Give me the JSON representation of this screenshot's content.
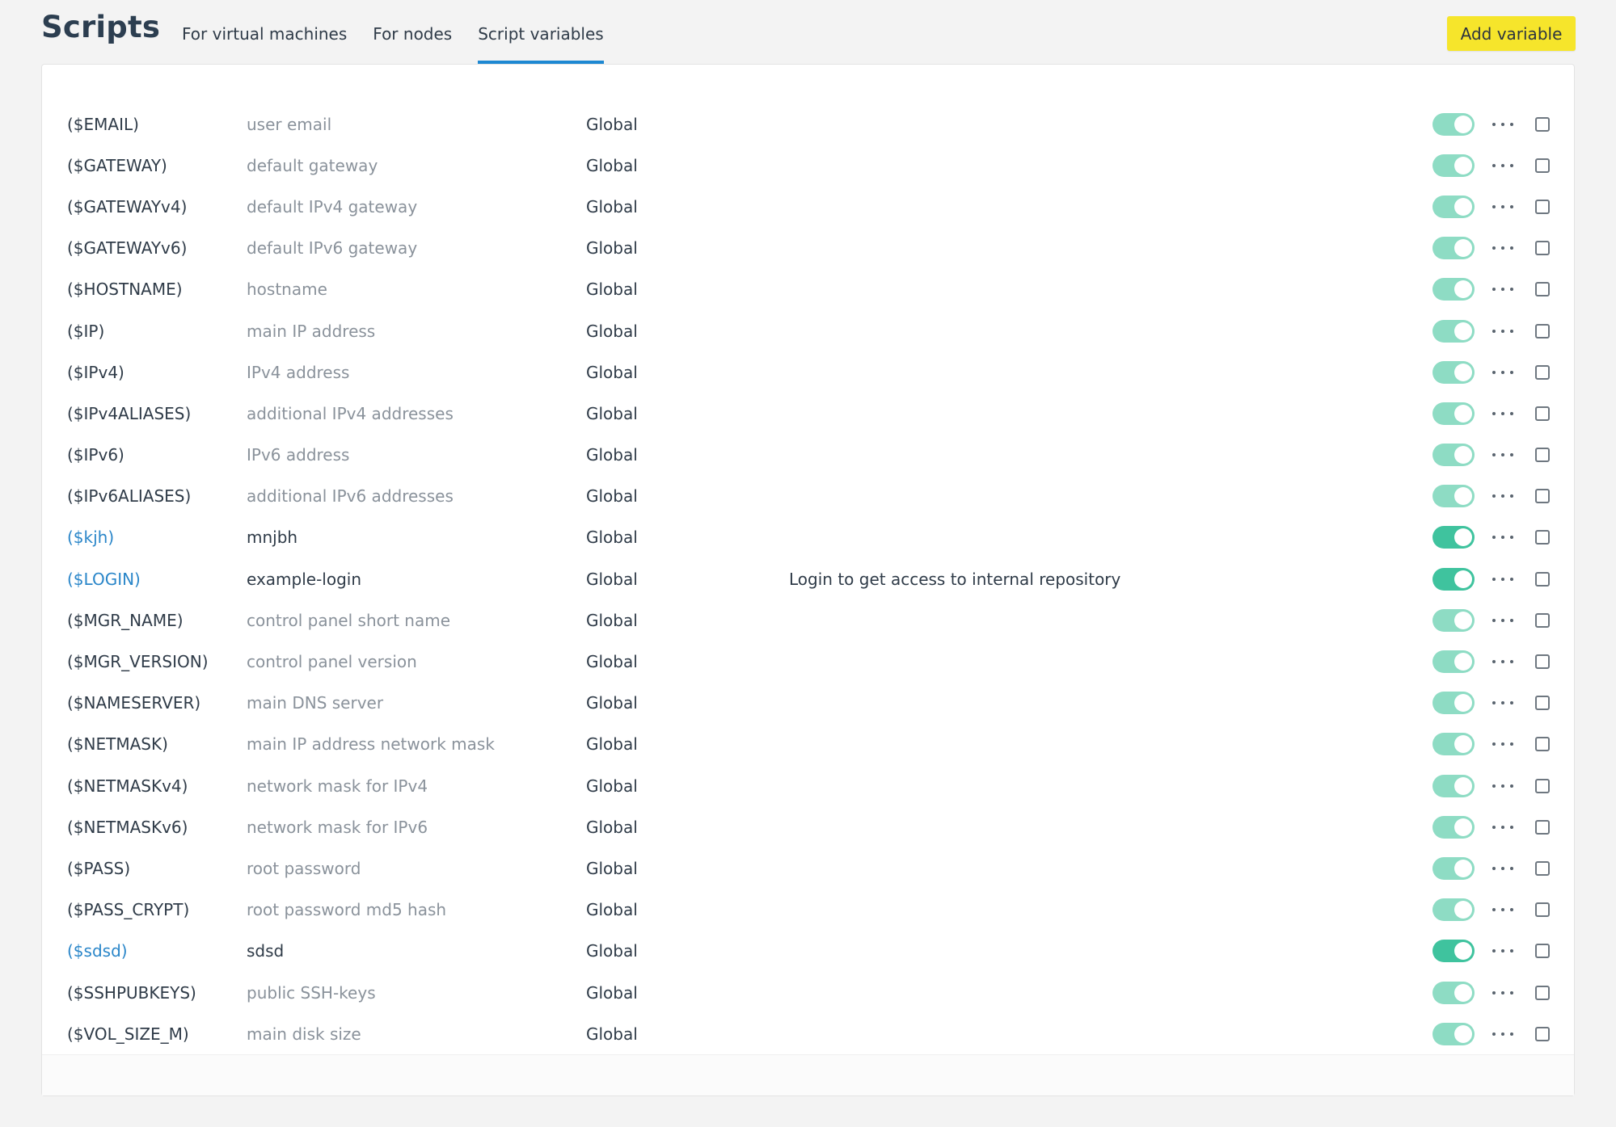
{
  "header": {
    "title": "Scripts",
    "tabs": [
      {
        "label": "For virtual machines",
        "active": false
      },
      {
        "label": "For nodes",
        "active": false
      },
      {
        "label": "Script variables",
        "active": true
      }
    ],
    "add_button": "Add variable"
  },
  "colors": {
    "accent_tab": "#1e88d2",
    "add_button": "#f6e52b",
    "toggle_system": "#8edcc4",
    "toggle_user": "#3fc39e",
    "link": "#2a86c9"
  },
  "rows": [
    {
      "name": "($EMAIL)",
      "description": "user email",
      "scope": "Global",
      "note": "",
      "user_defined": false
    },
    {
      "name": "($GATEWAY)",
      "description": "default gateway",
      "scope": "Global",
      "note": "",
      "user_defined": false
    },
    {
      "name": "($GATEWAYv4)",
      "description": "default IPv4 gateway",
      "scope": "Global",
      "note": "",
      "user_defined": false
    },
    {
      "name": "($GATEWAYv6)",
      "description": "default IPv6 gateway",
      "scope": "Global",
      "note": "",
      "user_defined": false
    },
    {
      "name": "($HOSTNAME)",
      "description": "hostname",
      "scope": "Global",
      "note": "",
      "user_defined": false
    },
    {
      "name": "($IP)",
      "description": "main IP address",
      "scope": "Global",
      "note": "",
      "user_defined": false
    },
    {
      "name": "($IPv4)",
      "description": "IPv4 address",
      "scope": "Global",
      "note": "",
      "user_defined": false
    },
    {
      "name": "($IPv4ALIASES)",
      "description": "additional IPv4 addresses",
      "scope": "Global",
      "note": "",
      "user_defined": false
    },
    {
      "name": "($IPv6)",
      "description": "IPv6 address",
      "scope": "Global",
      "note": "",
      "user_defined": false
    },
    {
      "name": "($IPv6ALIASES)",
      "description": "additional IPv6 addresses",
      "scope": "Global",
      "note": "",
      "user_defined": false
    },
    {
      "name": "($kjh)",
      "description": "mnjbh",
      "scope": "Global",
      "note": "",
      "user_defined": true
    },
    {
      "name": "($LOGIN)",
      "description": "example-login",
      "scope": "Global",
      "note": "Login to get access to internal repository",
      "user_defined": true
    },
    {
      "name": "($MGR_NAME)",
      "description": "control panel short name",
      "scope": "Global",
      "note": "",
      "user_defined": false
    },
    {
      "name": "($MGR_VERSION)",
      "description": "control panel version",
      "scope": "Global",
      "note": "",
      "user_defined": false
    },
    {
      "name": "($NAMESERVER)",
      "description": "main DNS server",
      "scope": "Global",
      "note": "",
      "user_defined": false
    },
    {
      "name": "($NETMASK)",
      "description": "main IP address network mask",
      "scope": "Global",
      "note": "",
      "user_defined": false
    },
    {
      "name": "($NETMASKv4)",
      "description": "network mask for IPv4",
      "scope": "Global",
      "note": "",
      "user_defined": false
    },
    {
      "name": "($NETMASKv6)",
      "description": "network mask for IPv6",
      "scope": "Global",
      "note": "",
      "user_defined": false
    },
    {
      "name": "($PASS)",
      "description": "root password",
      "scope": "Global",
      "note": "",
      "user_defined": false
    },
    {
      "name": "($PASS_CRYPT)",
      "description": "root password md5 hash",
      "scope": "Global",
      "note": "",
      "user_defined": false
    },
    {
      "name": "($sdsd)",
      "description": "sdsd",
      "scope": "Global",
      "note": "",
      "user_defined": true
    },
    {
      "name": "($SSHPUBKEYS)",
      "description": "public SSH-keys",
      "scope": "Global",
      "note": "",
      "user_defined": false
    },
    {
      "name": "($VOL_SIZE_M)",
      "description": "main disk size",
      "scope": "Global",
      "note": "",
      "user_defined": false
    }
  ]
}
